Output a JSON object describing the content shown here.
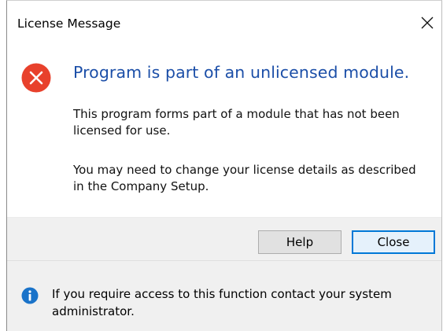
{
  "window": {
    "title": "License Message",
    "close_icon": "close-x-icon"
  },
  "message": {
    "icon": "error-icon",
    "icon_color": "#e8412c",
    "heading": "Program is part of an unlicensed module.",
    "heading_color": "#1c4fa8",
    "paragraph1": "This program forms part of a module that has not been licensed for use.",
    "paragraph2": "You may need to change your license details as described in the Company Setup."
  },
  "buttons": {
    "help_label": "Help",
    "close_label": "Close",
    "default_button": "close",
    "focus_color": "#0078d7"
  },
  "footer": {
    "icon": "info-icon",
    "icon_color": "#1a73c9",
    "text": "If you require access to this function contact your system administrator."
  }
}
